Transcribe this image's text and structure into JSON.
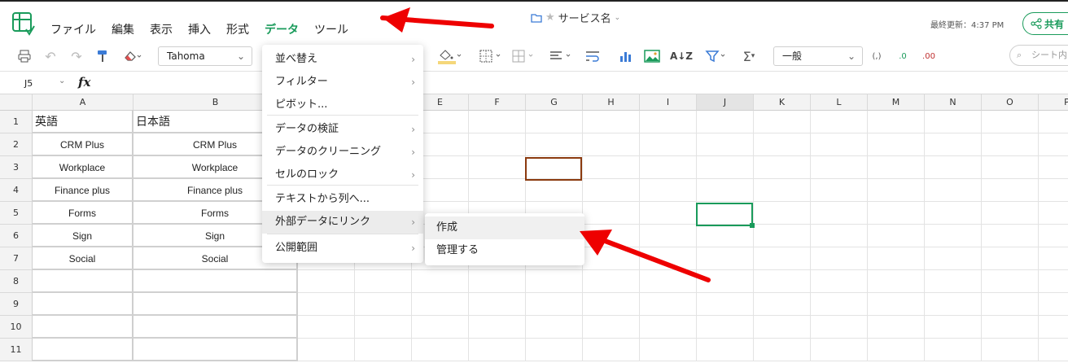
{
  "app": {
    "menu": [
      "ファイル",
      "編集",
      "表示",
      "挿入",
      "形式",
      "データ",
      "ツール"
    ],
    "active_menu_index": 5,
    "doc_title": "サービス名",
    "last_update": "最終更新：4:37 PM",
    "share_label": "共有",
    "accent_color": "#1a9b5b"
  },
  "toolbar": {
    "font": "Tahoma",
    "number_format": "一般",
    "search_placeholder": "シート内",
    "paren_glyph": "(,)",
    "decimal_inc": ".0",
    "decimal_dec": ".00"
  },
  "formula_bar": {
    "cell_ref": "J5",
    "fx": "fx"
  },
  "grid": {
    "columns": [
      "A",
      "B",
      "C",
      "D",
      "E",
      "F",
      "G",
      "H",
      "I",
      "J",
      "K",
      "L",
      "M",
      "N",
      "O",
      "P"
    ],
    "selected_column": "J",
    "rows": [
      "1",
      "2",
      "3",
      "4",
      "5",
      "6",
      "7",
      "8",
      "9",
      "10",
      "11"
    ],
    "col_a": [
      "英語",
      "CRM Plus",
      "Workplace",
      "Finance plus",
      "Forms",
      "Sign",
      "Social",
      "",
      "",
      "",
      ""
    ],
    "col_b": [
      "日本語",
      "CRM Plus",
      "Workplace",
      "Finance plus",
      "Forms",
      "Sign",
      "Social",
      "",
      "",
      "",
      ""
    ]
  },
  "data_menu": {
    "items": [
      {
        "label": "並べ替え",
        "submenu": true
      },
      {
        "label": "フィルター",
        "submenu": true
      },
      {
        "label": "ピボット...",
        "submenu": false
      },
      {
        "label": "データの検証",
        "submenu": true
      },
      {
        "label": "データのクリーニング",
        "submenu": true
      },
      {
        "label": "セルのロック",
        "submenu": true
      },
      {
        "label": "テキストから列へ...",
        "submenu": false
      },
      {
        "label": "外部データにリンク",
        "submenu": true
      },
      {
        "label": "公開範囲",
        "submenu": true
      }
    ],
    "hovered_index": 7,
    "submenu_items": [
      "作成",
      "管理する"
    ]
  }
}
